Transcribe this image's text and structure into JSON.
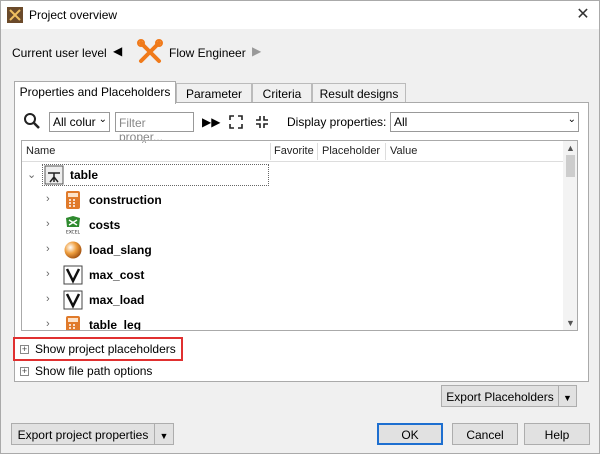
{
  "window": {
    "title": "Project overview",
    "close_glyph": "✕"
  },
  "user_level": {
    "label": "Current user level",
    "value": "Flow Engineer",
    "prev_glyph": "◀",
    "next_glyph": "▶"
  },
  "tabs": [
    {
      "label": "Properties and Placeholders",
      "active": true
    },
    {
      "label": "Parameter",
      "active": false
    },
    {
      "label": "Criteria",
      "active": false
    },
    {
      "label": "Result designs",
      "active": false
    }
  ],
  "toolbar": {
    "column_select": "All colur",
    "filter_placeholder": "Filter proper...",
    "display_label": "Display properties:",
    "display_value": "All",
    "icons": [
      "search-icon",
      "fast-forward-icon",
      "expand-all-icon",
      "collapse-all-icon"
    ]
  },
  "tree": {
    "columns": [
      "Name",
      "Favorite",
      "Placeholder",
      "Value"
    ],
    "root": {
      "label": "table",
      "icon": "table-icon"
    },
    "children": [
      {
        "label": "construction",
        "icon": "calculator-icon"
      },
      {
        "label": "costs",
        "icon": "excel-icon"
      },
      {
        "label": "load_slang",
        "icon": "sphere-icon"
      },
      {
        "label": "max_cost",
        "icon": "variable-icon"
      },
      {
        "label": "max_load",
        "icon": "variable-icon"
      },
      {
        "label": "table_leg",
        "icon": "calculator-icon"
      }
    ]
  },
  "options": {
    "show_placeholders": "Show project placeholders",
    "show_file_path": "Show file path options"
  },
  "buttons": {
    "export_placeholders": "Export Placeholders",
    "export_properties": "Export project properties",
    "ok": "OK",
    "cancel": "Cancel",
    "help": "Help"
  },
  "colors": {
    "accent": "#1e6fd0",
    "highlight": "#e03030",
    "brand_orange": "#f07a1a"
  }
}
